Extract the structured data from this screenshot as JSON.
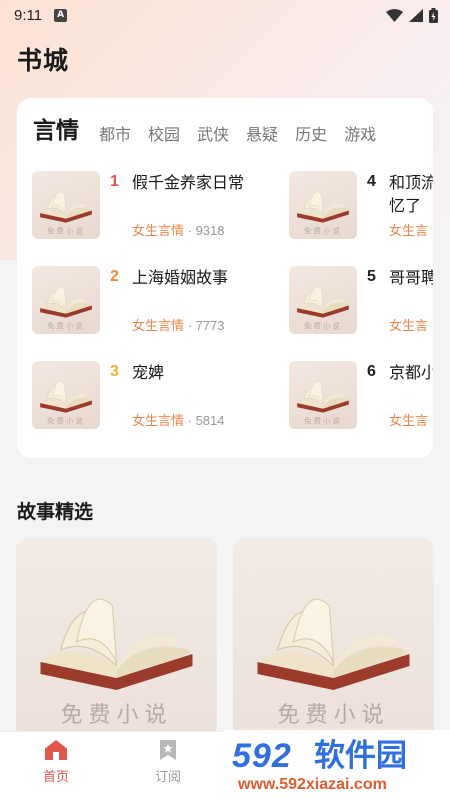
{
  "status_bar": {
    "time": "9:11",
    "notif_letter": "A"
  },
  "page": {
    "title": "书城"
  },
  "category": {
    "tabs": [
      {
        "label": "言情",
        "active": true
      },
      {
        "label": "都市"
      },
      {
        "label": "校园"
      },
      {
        "label": "武侠"
      },
      {
        "label": "悬疑"
      },
      {
        "label": "历史"
      },
      {
        "label": "游戏"
      }
    ],
    "books": [
      {
        "rank": "1",
        "title": "假千金养家日常",
        "genre": "女生言情",
        "sep": " · ",
        "count": "9318",
        "rank_color": "#e2574c"
      },
      {
        "rank": "2",
        "title": "上海婚姻故事",
        "genre": "女生言情",
        "sep": " · ",
        "count": "7773",
        "rank_color": "#f08a3c"
      },
      {
        "rank": "3",
        "title": "宠婢",
        "genre": "女生言情",
        "sep": " · ",
        "count": "5814",
        "rank_color": "#f2b13a"
      },
      {
        "rank": "4",
        "title": "和顶流",
        "title2": "忆了",
        "genre": "女生言",
        "rank_color": "#222222"
      },
      {
        "rank": "5",
        "title": "哥哥聘",
        "genre": "女生言",
        "rank_color": "#222222"
      },
      {
        "rank": "6",
        "title": "京都小",
        "genre": "女生言",
        "rank_color": "#222222"
      }
    ],
    "cover_text": "免费小说"
  },
  "stories": {
    "title": "故事精选",
    "cover_text": "免费小说"
  },
  "bottom_nav": {
    "items": [
      {
        "label": "首页",
        "active": true,
        "icon": "home-icon"
      },
      {
        "label": "订阅",
        "active": false,
        "icon": "bookmark-icon"
      }
    ]
  },
  "watermark": {
    "logo_num": "592",
    "logo_cn": "软件园",
    "url": "www.592xiazai.com"
  },
  "colors": {
    "accent": "#e8874a",
    "active_nav": "#e2574c"
  }
}
